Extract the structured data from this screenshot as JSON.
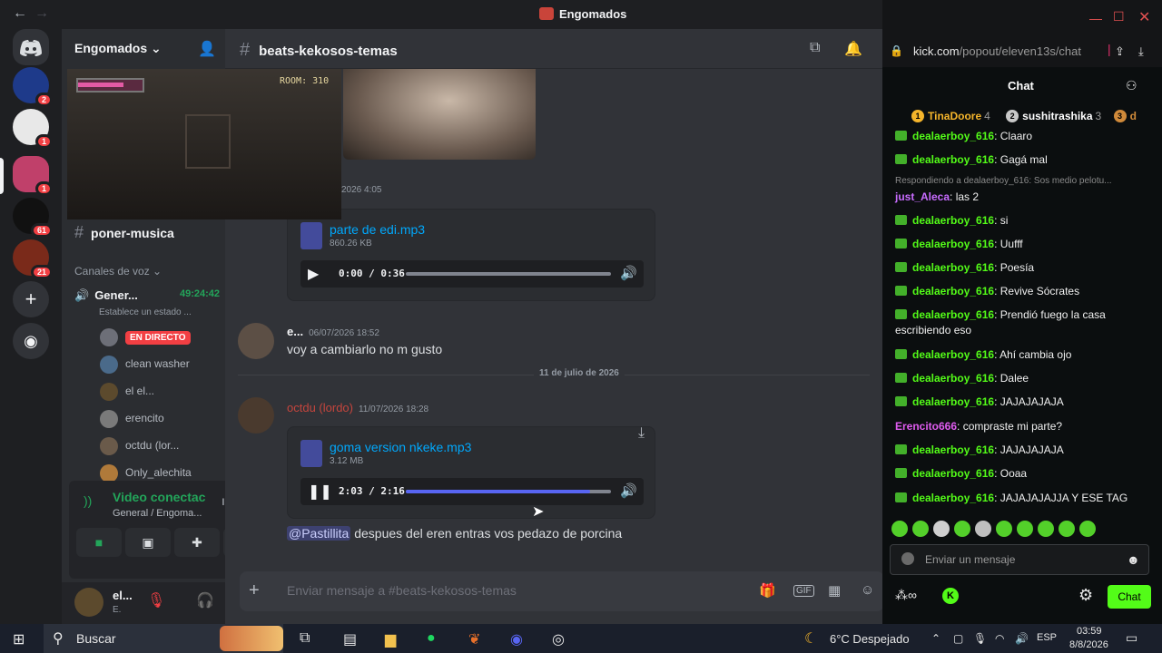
{
  "window": {
    "title": "Engomados"
  },
  "server": {
    "name": "Engomados"
  },
  "rail": {
    "badges": [
      "2",
      "1",
      "1",
      "61",
      "21"
    ]
  },
  "video_overlay": {
    "room": "ROOM: 310"
  },
  "sidebar": {
    "text_channel": "poner-musica",
    "voice_category": "Canales de voz",
    "voice_channel": {
      "name": "Gener...",
      "timer": "49:24:42",
      "status": "Establece un estado ..."
    },
    "voice_users": [
      {
        "name": "",
        "live": "EN DIRECTO"
      },
      {
        "name": "clean washer"
      },
      {
        "name": "el el..."
      },
      {
        "name": "erencito"
      },
      {
        "name": "octdu (lor..."
      },
      {
        "name": "Only_alechita"
      }
    ]
  },
  "voice_panel": {
    "title": "Video conectac",
    "subtitle": "General / Engoma..."
  },
  "user_panel": {
    "name": "el...",
    "status": "E."
  },
  "channel": {
    "name": "beats-kekosos-temas"
  },
  "messages": {
    "first_time": "2026 4:05",
    "attach1": {
      "name": "parte de edi.mp3",
      "size": "860.26 KB",
      "time": "0:00 / 0:36",
      "progress": 0
    },
    "msg2": {
      "author": "e...",
      "time": "06/07/2026 18:52",
      "text": "voy a cambiarlo no m gusto"
    },
    "divider": "11 de julio de 2026",
    "msg3": {
      "author": "octdu (lordo)",
      "time": "11/07/2026 18:28"
    },
    "attach2": {
      "name": "goma version nkeke.mp3",
      "size": "3.12 MB",
      "time": "2:03 / 2:16",
      "progress": 0.9
    },
    "msg4": {
      "mention": "@Pastillita",
      "text": " despues del eren entras vos pedazo de porcina"
    }
  },
  "composer": {
    "placeholder": "Enviar mensaje a #beats-kekosos-temas"
  },
  "kick": {
    "url_host": "kick.com",
    "url_path": "/popout/eleven13s/chat",
    "header": "Chat",
    "gifters": [
      {
        "rank": "1",
        "name": "TinaDoore",
        "count": "4"
      },
      {
        "rank": "2",
        "name": "sushitrashika",
        "count": "3"
      },
      {
        "rank": "3",
        "name": "d",
        "count": ""
      }
    ],
    "reply_hint": "Respondiendo a dealaerboy_616: Sos medio pelotu...",
    "messages": [
      {
        "user": "dealaerboy_616",
        "text": "Claaro",
        "color": "green",
        "badge": true
      },
      {
        "user": "dealaerboy_616",
        "text": "Gagá mal",
        "color": "green",
        "badge": true
      },
      {
        "user": "just_Aleca",
        "text": "las 2",
        "color": "purple",
        "badge": false
      },
      {
        "user": "dealaerboy_616",
        "text": "si",
        "color": "green",
        "badge": true
      },
      {
        "user": "dealaerboy_616",
        "text": "Uufff",
        "color": "green",
        "badge": true
      },
      {
        "user": "dealaerboy_616",
        "text": "Poesía",
        "color": "green",
        "badge": true
      },
      {
        "user": "dealaerboy_616",
        "text": "Revive Sócrates",
        "color": "green",
        "badge": true
      },
      {
        "user": "dealaerboy_616",
        "text": "Prendió fuego la casa escribiendo eso",
        "color": "green",
        "badge": true
      },
      {
        "user": "dealaerboy_616",
        "text": "Ahí cambia ojo",
        "color": "green",
        "badge": true
      },
      {
        "user": "dealaerboy_616",
        "text": "Dalee",
        "color": "green",
        "badge": true
      },
      {
        "user": "dealaerboy_616",
        "text": "JAJAJAJAJA",
        "color": "green",
        "badge": true
      },
      {
        "user": "Erencito666",
        "text": "compraste mi parte?",
        "color": "pink",
        "badge": false
      },
      {
        "user": "dealaerboy_616",
        "text": "JAJAJAJAJA",
        "color": "green",
        "badge": true
      },
      {
        "user": "dealaerboy_616",
        "text": "Ooaa",
        "color": "green",
        "badge": true
      },
      {
        "user": "dealaerboy_616",
        "text": "JAJAJAJAJJA Y ESE TAG",
        "color": "green",
        "badge": true
      }
    ],
    "input_placeholder": "Enviar un mensaje",
    "send_label": "Chat"
  },
  "taskbar": {
    "search": "Buscar",
    "weather": "6°C Despejado",
    "lang": "ESP",
    "time": "03:59",
    "date": "8/8/2026"
  },
  "colors": {
    "accent": "#5865f2",
    "kick_green": "#53fc18",
    "live_red": "#f23f43"
  }
}
